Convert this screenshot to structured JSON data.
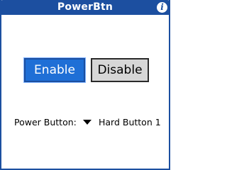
{
  "titlebar": {
    "title": "PowerBtn",
    "info_glyph": "i",
    "info_icon": "info-icon"
  },
  "buttons": {
    "enable_label": "Enable",
    "disable_label": "Disable"
  },
  "power_setting": {
    "label": "Power Button:",
    "selected_value": "Hard Button 1",
    "dropdown_icon": "triangle-down-icon"
  },
  "colors": {
    "titlebar": "#1c4fa0",
    "enable_bg": "#1f6fd6",
    "disable_bg": "#d6d6d6",
    "background": "#ffffff"
  }
}
